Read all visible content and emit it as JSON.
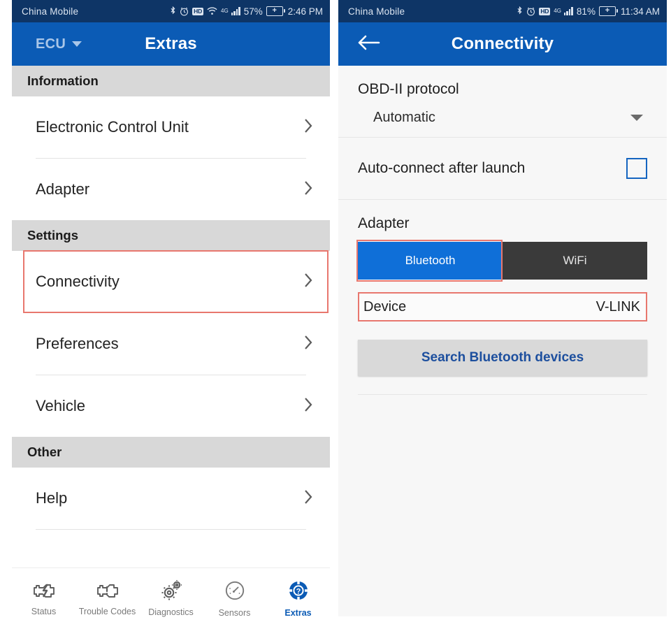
{
  "left": {
    "status_bar": {
      "carrier": "China Mobile",
      "network_label": "4G",
      "battery_percent": "57%",
      "time": "2:46 PM",
      "icons": [
        "bluetooth-icon",
        "alarm-icon",
        "hd-icon",
        "wifi-icon",
        "signal-icon",
        "battery-charging-icon"
      ],
      "hd_label": "HD"
    },
    "app_bar": {
      "menu_label": "ECU",
      "title": "Extras"
    },
    "sections": [
      {
        "header": "Information",
        "items": [
          {
            "label": "Electronic Control Unit",
            "highlighted": false
          },
          {
            "label": "Adapter",
            "highlighted": false
          }
        ]
      },
      {
        "header": "Settings",
        "items": [
          {
            "label": "Connectivity",
            "highlighted": true
          },
          {
            "label": "Preferences",
            "highlighted": false
          },
          {
            "label": "Vehicle",
            "highlighted": false
          }
        ]
      },
      {
        "header": "Other",
        "items": [
          {
            "label": "Help",
            "highlighted": false
          }
        ]
      }
    ],
    "tabs": [
      {
        "label": "Status",
        "icon": "engine-bolt-icon",
        "active": false
      },
      {
        "label": "Trouble Codes",
        "icon": "engine-warning-icon",
        "active": false
      },
      {
        "label": "Diagnostics",
        "icon": "gears-icon",
        "active": false
      },
      {
        "label": "Sensors",
        "icon": "gauge-icon",
        "active": false
      },
      {
        "label": "Extras",
        "icon": "life-ring-help-icon",
        "active": true
      }
    ]
  },
  "right": {
    "status_bar": {
      "carrier": "China Mobile",
      "network_label": "4G",
      "battery_percent": "81%",
      "time": "11:34 AM",
      "icons": [
        "bluetooth-icon",
        "alarm-icon",
        "hd-icon",
        "signal-icon",
        "battery-charging-icon"
      ],
      "hd_label": "HD"
    },
    "app_bar": {
      "title": "Connectivity",
      "back_icon": "back-arrow-icon"
    },
    "protocol": {
      "label": "OBD-II protocol",
      "value": "Automatic"
    },
    "auto_connect": {
      "label": "Auto-connect after launch",
      "checked": false
    },
    "adapter": {
      "label": "Adapter",
      "options": [
        "Bluetooth",
        "WiFi"
      ],
      "selected": "Bluetooth"
    },
    "device": {
      "label": "Device",
      "value": "V-LINK"
    },
    "search_button": {
      "label": "Search Bluetooth devices"
    }
  },
  "colors": {
    "status_bar_bg": "#0e3566",
    "app_bar_bg": "#0b5bb5",
    "accent_blue": "#0f6fd8",
    "highlight_red": "#e8776e",
    "section_header_bg": "#d8d8d8",
    "panel_bg": "#f7f7f7",
    "link_blue": "#1d4f9e"
  }
}
